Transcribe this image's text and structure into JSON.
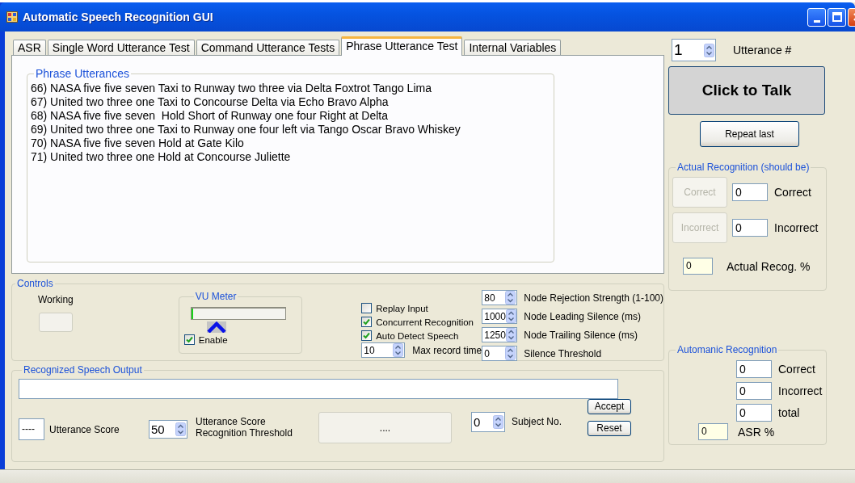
{
  "window": {
    "title": "Automatic Speech Recognition GUI"
  },
  "tabs": [
    {
      "label": "ASR",
      "selected": false
    },
    {
      "label": "Single Word Utterance Test",
      "selected": false
    },
    {
      "label": "Command Utterance Tests",
      "selected": false
    },
    {
      "label": "Phrase Utterance Test",
      "selected": true
    },
    {
      "label": "Internal Variables",
      "selected": false
    }
  ],
  "phrase_utterances": {
    "title": "Phrase Utterances",
    "lines": [
      "66) NASA five five seven Taxi to Runway two three via Delta Foxtrot Tango Lima",
      "67) United two three one Taxi to Concourse Delta via Echo Bravo Alpha",
      "68) NASA five five seven  Hold Short of Runway one four Right at Delta",
      "69) United two three one Taxi to Runway one four left via Tango Oscar Bravo Whiskey",
      "70) NASA five five seven Hold at Gate Kilo",
      "71) United two three one Hold at Concourse Juliette"
    ]
  },
  "controls": {
    "title": "Controls",
    "working_label": "Working",
    "vu_meter": {
      "title": "VU Meter",
      "level": 0.02,
      "enable": {
        "label": "Enable",
        "checked": true
      }
    },
    "checkboxes": [
      {
        "label": "Replay Input",
        "checked": false
      },
      {
        "label": "Concurrent Recognition",
        "checked": true
      },
      {
        "label": "Auto Detect Speech",
        "checked": true
      }
    ],
    "max_record": {
      "value": "10",
      "label": "Max record time"
    },
    "spinners": [
      {
        "value": "80",
        "label": "Node Rejection Strength (1-100)"
      },
      {
        "value": "1000",
        "label": "Node Leading Silence (ms)"
      },
      {
        "value": "1250",
        "label": "Node Trailing Silence (ms)"
      },
      {
        "value": "0",
        "label": "Silence Threshold"
      }
    ]
  },
  "output": {
    "title": "Recognized Speech Output",
    "score": {
      "value": "----",
      "label": "Utterance Score"
    },
    "threshold": {
      "value": "50",
      "label": "Utterance Score Recognition Threshold"
    },
    "status_button": "....",
    "subject": {
      "value": "0",
      "label": "Subject No."
    },
    "buttons": [
      "Accept",
      "Reset"
    ]
  },
  "utterance_number": {
    "value": "1",
    "label": "Utterance #"
  },
  "talk_button": "Click to Talk",
  "repeat_button": "Repeat last",
  "actual_recognition": {
    "title": "Actual Recognition (should be)",
    "rows": [
      {
        "button": "Correct",
        "disabled": true,
        "value": "0",
        "label": "Correct"
      },
      {
        "button": "Incorrect",
        "disabled": true,
        "value": "0",
        "label": "Incorrect"
      }
    ],
    "percent": {
      "value": "0",
      "label": "Actual Recog. %"
    }
  },
  "automatic_recognition": {
    "title": "Automanic Recognition",
    "rows": [
      {
        "value": "0",
        "label": "Correct"
      },
      {
        "value": "0",
        "label": "Incorrect"
      },
      {
        "value": "0",
        "label": "total"
      }
    ],
    "percent": {
      "value": "0",
      "label": "ASR %"
    }
  }
}
